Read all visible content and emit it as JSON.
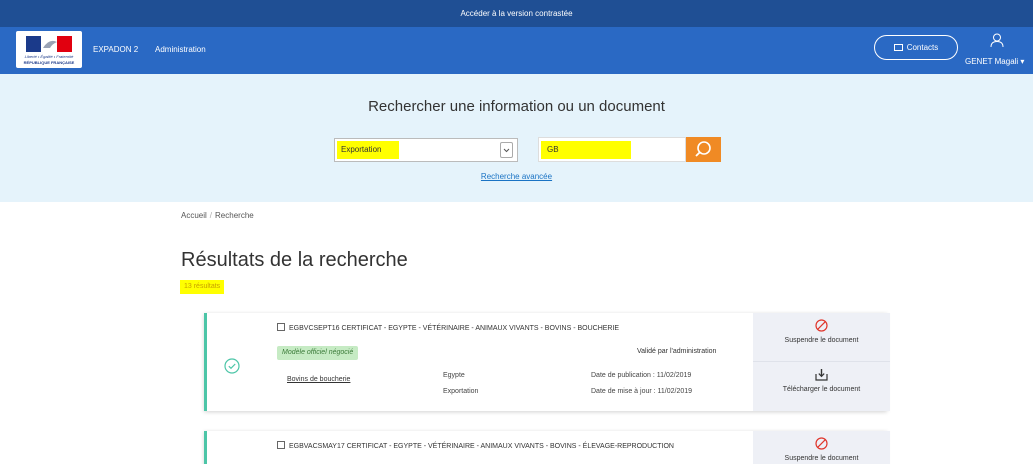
{
  "topbar": {
    "contrast_label": "Accéder à la version contrastée"
  },
  "header": {
    "logo_motto": "Liberté • Égalité • Fraternité",
    "logo_name": "RÉPUBLIQUE FRANÇAISE",
    "nav": [
      "EXPADON 2",
      "Administration"
    ],
    "contacts_label": "Contacts",
    "user_name": "GENET Magali"
  },
  "search": {
    "title": "Rechercher une information ou un document",
    "flux_value": "Exportation",
    "query_value": "GB",
    "advanced_link": "Recherche avancée"
  },
  "breadcrumb": [
    "Accueil",
    "Recherche"
  ],
  "results": {
    "title": "Résultats de la recherche",
    "count_label": "13 résultats",
    "items": [
      {
        "title": "EGBVCSEPT16 CERTIFICAT - EGYPTE - VÉTÉRINAIRE - ANIMAUX VIVANTS - BOVINS - BOUCHERIE",
        "badge": "Modèle officiel négocié",
        "validated": "Validé par l'administration",
        "category": "Bovins de boucherie",
        "country": "Egypte",
        "flux": "Exportation",
        "pub_date": "Date de publication : 11/02/2019",
        "upd_date": "Date de mise à jour : 11/02/2019",
        "action_suspend": "Suspendre le document",
        "action_download": "Télécharger le document"
      },
      {
        "title": "EGBVACSMAY17 CERTIFICAT - EGYPTE - VÉTÉRINAIRE - ANIMAUX VIVANTS - BOVINS - ÉLEVAGE-REPRODUCTION",
        "action_suspend": "Suspendre le document"
      }
    ]
  },
  "colors": {
    "header_blue": "#2a69c4",
    "search_orange": "#f08a24",
    "accent_teal": "#4cc5a7",
    "highlight": "#ffff00"
  }
}
